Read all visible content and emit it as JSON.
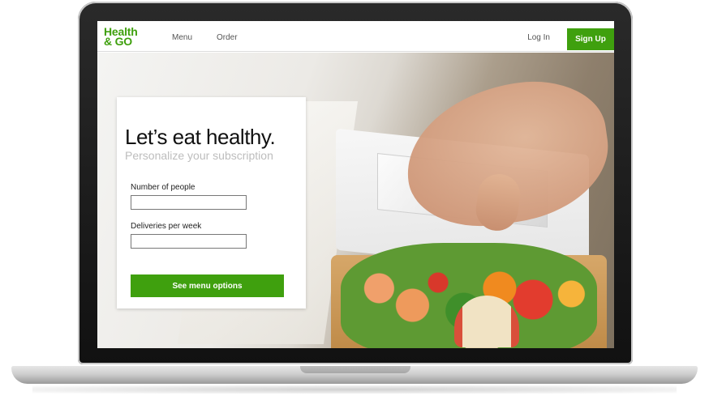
{
  "nav": {
    "logo_line1": "Health",
    "logo_line2": "& GO",
    "menu": "Menu",
    "order": "Order",
    "login": "Log In",
    "signup": "Sign Up"
  },
  "hero": {
    "headline": "Let’s eat healthy.",
    "subheadline": "Personalize your subscription"
  },
  "form": {
    "people_label": "Number of people",
    "people_value": "",
    "deliveries_label": "Deliveries per week",
    "deliveries_value": "",
    "cta": "See menu options"
  },
  "colors": {
    "brand_green": "#3fa00e",
    "subhead_gray": "#bdbdbd"
  }
}
